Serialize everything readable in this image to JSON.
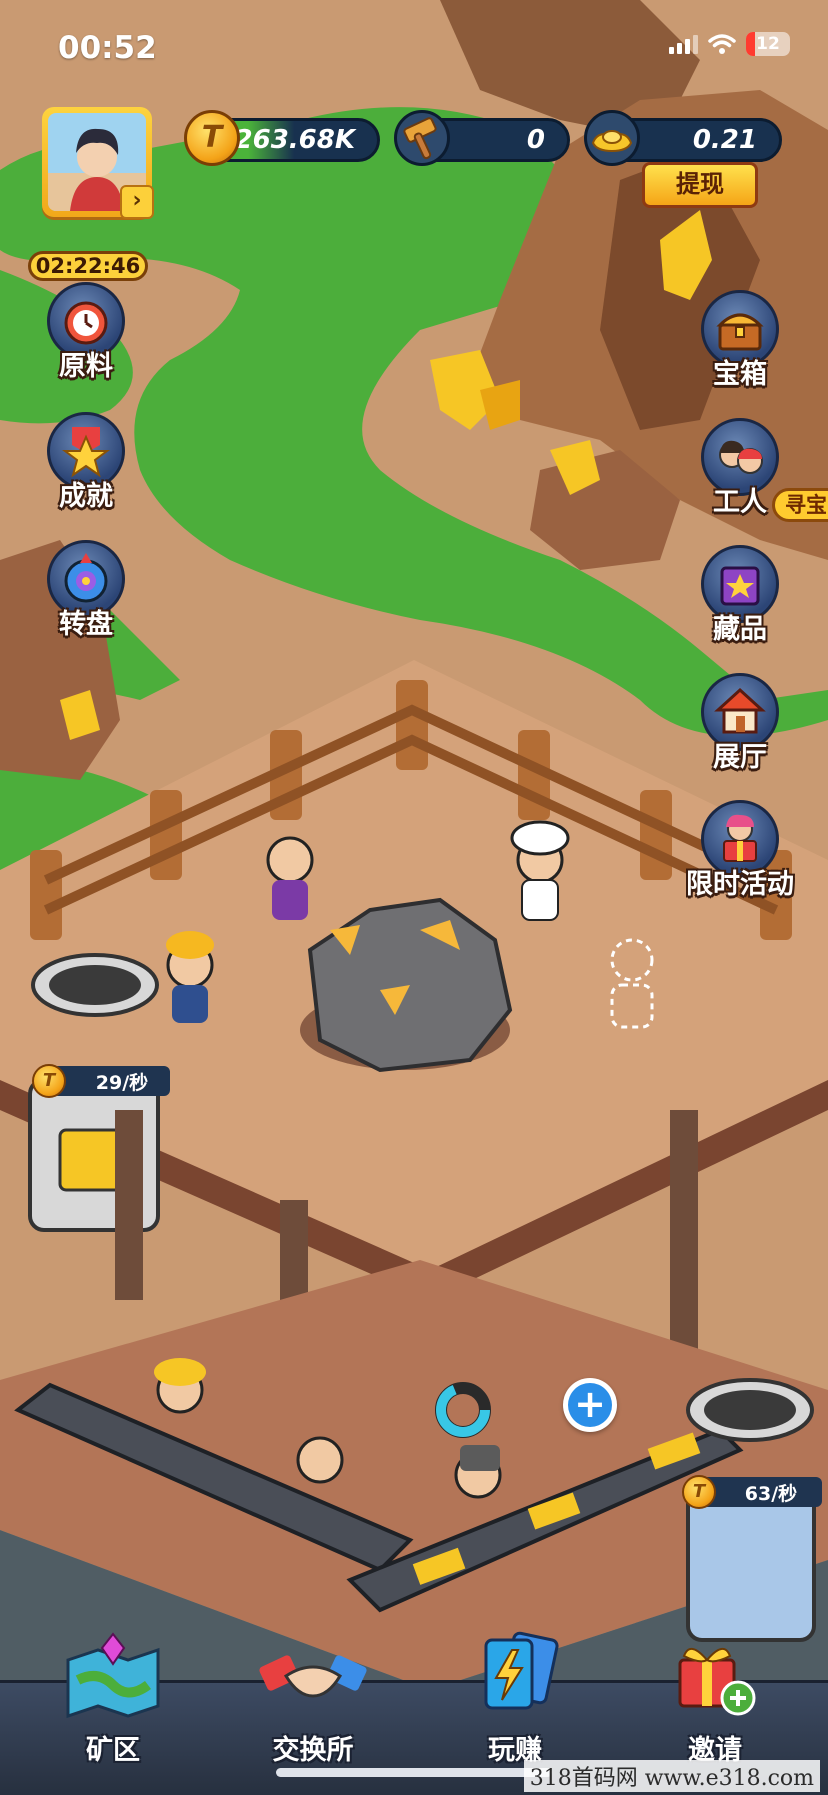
{
  "status_bar": {
    "time": "00:52",
    "battery": "12"
  },
  "resources": {
    "coins": "263.68K",
    "hammers": "0",
    "gold": "0.21",
    "withdraw_label": "提现"
  },
  "timer": "02:22:46",
  "left_menu": [
    {
      "label": "原料",
      "icon": "alarm-clock-icon"
    },
    {
      "label": "成就",
      "icon": "star-medal-icon"
    },
    {
      "label": "转盘",
      "icon": "roulette-wheel-icon"
    }
  ],
  "right_menu": [
    {
      "label": "宝箱",
      "icon": "treasure-chest-icon"
    },
    {
      "label": "工人",
      "icon": "workers-icon"
    },
    {
      "label": "藏品",
      "icon": "collection-book-icon"
    },
    {
      "label": "展厅",
      "icon": "house-icon"
    },
    {
      "label": "限时活动",
      "icon": "gift-girl-icon"
    }
  ],
  "treasure_tag": "寻宝",
  "rates": {
    "upper": "29/秒",
    "lower": "63/秒"
  },
  "coin_symbol": "T",
  "bottom_nav": [
    {
      "label": "矿区",
      "icon": "map-icon"
    },
    {
      "label": "交换所",
      "icon": "handshake-icon"
    },
    {
      "label": "玩赚",
      "icon": "lightning-cards-icon"
    },
    {
      "label": "邀请",
      "icon": "gift-plus-icon"
    }
  ],
  "watermark": "318首码网 www.e318.com",
  "colors": {
    "grass": "#4cae3b",
    "dirt": "#c99a72",
    "panel": "#1f3450",
    "gold": "#f4a318"
  }
}
